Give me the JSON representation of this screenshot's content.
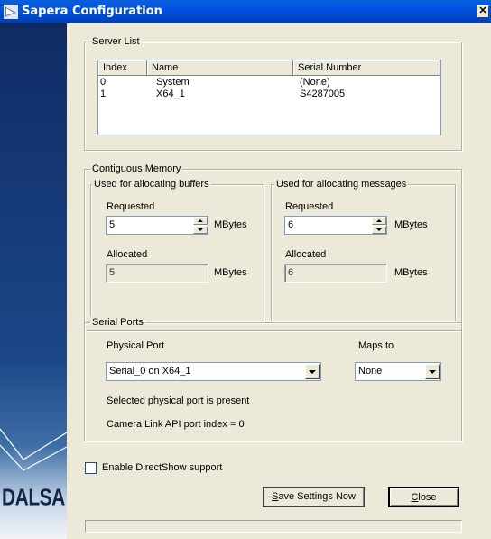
{
  "window": {
    "title": "Sapera Configuration",
    "close_glyph": "✕",
    "icon": "sapera-app-icon"
  },
  "sidebar": {
    "logo_text": "DALSA"
  },
  "server_list": {
    "title": "Server List",
    "columns": [
      "Index",
      "Name",
      "Serial Number"
    ],
    "rows": [
      {
        "index": "0",
        "name": "System",
        "serial": "(None)"
      },
      {
        "index": "1",
        "name": "X64_1",
        "serial": "S4287005"
      }
    ]
  },
  "contiguous_memory": {
    "title": "Contiguous Memory",
    "buffers": {
      "title": "Used for allocating buffers",
      "requested_label": "Requested",
      "requested_value": "5",
      "allocated_label": "Allocated",
      "allocated_value": "5",
      "unit": "MBytes"
    },
    "messages": {
      "title": "Used for allocating messages",
      "requested_label": "Requested",
      "requested_value": "6",
      "allocated_label": "Allocated",
      "allocated_value": "6",
      "unit": "MBytes"
    }
  },
  "serial_ports": {
    "title": "Serial Ports",
    "physical_port_label": "Physical Port",
    "physical_port_value": "Serial_0 on X64_1",
    "maps_to_label": "Maps to",
    "maps_to_value": "None",
    "status_text": "Selected physical port is present",
    "api_index_text": "Camera Link API port index = 0"
  },
  "directshow": {
    "label": "Enable DirectShow support",
    "checked": false
  },
  "buttons": {
    "save_prefix": "S",
    "save_rest": "ave Settings Now",
    "close_prefix": "C",
    "close_rest": "lose"
  },
  "progress": {
    "value": 0
  },
  "colors": {
    "titlebar": "#0054e3",
    "dialog_bg": "#ece9d8",
    "sidebar_dark": "#0f2b64"
  }
}
